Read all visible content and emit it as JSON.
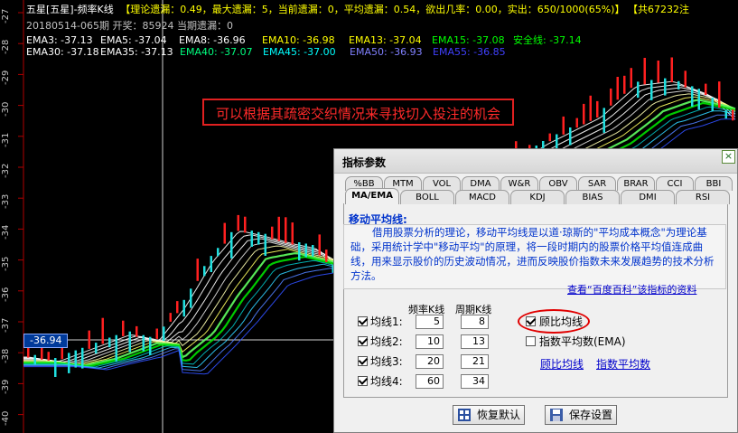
{
  "header": {
    "line1_name": "五星[五星]-频率K线",
    "line1_stats": "【理论遗漏：0.49，最大遗漏：5，当前遗漏：0，平均遗漏：0.54，欲出几率：0.00，实出：650/1000(65%)】",
    "line1_tail": "【共67232注",
    "line2": "20180514-065期 开奖：85924 当期遗漏：0",
    "ema_row1": [
      {
        "label": "EMA3: -37.13",
        "color": "#ffffff"
      },
      {
        "label": "EMA5: -37.04",
        "color": "#ffffff"
      },
      {
        "label": "EMA8: -36.96",
        "color": "#ffffff"
      },
      {
        "label": "EMA10: -36.98",
        "color": "#ffff00"
      },
      {
        "label": "EMA13: -37.04",
        "color": "#ffff00"
      },
      {
        "label": "EMA15: -37.08",
        "color": "#00ff00"
      },
      {
        "label": "安全线: -37.14",
        "color": "#00ff00"
      }
    ],
    "ema_row2": [
      {
        "label": "EMA30: -37.18",
        "color": "#ffffff"
      },
      {
        "label": "EMA35: -37.13",
        "color": "#ffffff"
      },
      {
        "label": "EMA40: -37.07",
        "color": "#00ff7f"
      },
      {
        "label": "EMA45: -37.00",
        "color": "#00ffff"
      },
      {
        "label": "EMA50: -36.93",
        "color": "#8080ff"
      },
      {
        "label": "EMA55: -36.85",
        "color": "#4040ff"
      }
    ]
  },
  "y_axis_labels": [
    "-27",
    "-28",
    "-29",
    "-30",
    "-31",
    "-32",
    "-33",
    "-34",
    "-35",
    "-36",
    "-37",
    "-38",
    "-39",
    "-40"
  ],
  "annotation": "可以根据其疏密交织情况来寻找切入投注的机会",
  "price_tag": "-36.94",
  "dialog": {
    "title": "指标参数",
    "close": "×",
    "tabs_row1": [
      "%BB",
      "MTM",
      "VOL",
      "DMA",
      "W&R",
      "OBV",
      "SAR",
      "BRAR",
      "CCI",
      "BBI"
    ],
    "tabs_row2": [
      "MA/EMA",
      "BOLL",
      "MACD",
      "KDJ",
      "BIAS",
      "DMI",
      "RSI"
    ],
    "active_tab": "MA/EMA",
    "section_title": "移动平均线:",
    "description": "借用股票分析的理论，移动平均线是以道·琼斯的\"平均成本概念\"为理论基础，采用统计学中\"移动平均\"的原理，将一段时期内的股票价格平均值连成曲线，用来显示股价的历史波动情况，进而反映股价指数未来发展趋势的技术分析方法。",
    "baike_link": "查看“百度百科”该指标的资料",
    "col_freq": "频率K线",
    "col_period": "周期K线",
    "lines": [
      {
        "label": "均线1:",
        "freq": "5",
        "period": "8",
        "checked": true
      },
      {
        "label": "均线2:",
        "freq": "10",
        "period": "13",
        "checked": true
      },
      {
        "label": "均线3:",
        "freq": "20",
        "period": "21",
        "checked": true
      },
      {
        "label": "均线4:",
        "freq": "60",
        "period": "34",
        "checked": true
      }
    ],
    "opt_ratio": "顾比均线",
    "opt_ratio_checked": true,
    "opt_ema": "指数平均数(EMA)",
    "opt_ema_checked": false,
    "link_ratio": "顾比均线",
    "link_ema": "指数平均数",
    "btn_restore": "恢复默认",
    "btn_save": "保存设置"
  }
}
